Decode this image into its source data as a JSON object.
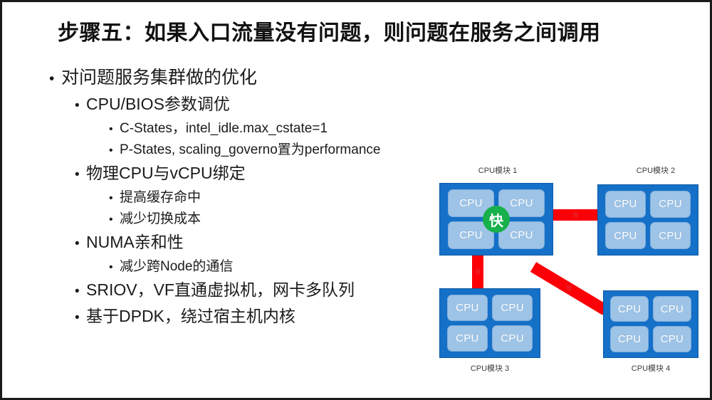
{
  "slide": {
    "title": "步骤五：如果入口流量没有问题，则问题在服务之间调用",
    "bullet_char": "•"
  },
  "outline": [
    {
      "level": 1,
      "text": "对问题服务集群做的优化"
    },
    {
      "level": 2,
      "text": "CPU/BIOS参数调优"
    },
    {
      "level": 3,
      "text": "C-States，intel_idle.max_cstate=1"
    },
    {
      "level": 3,
      "text": "P-States, scaling_governo置为performance"
    },
    {
      "level": 2,
      "text": "物理CPU与vCPU绑定"
    },
    {
      "level": 3,
      "text": "提高缓存命中"
    },
    {
      "level": 3,
      "text": "减少切换成本"
    },
    {
      "level": 2,
      "text": "NUMA亲和性"
    },
    {
      "level": 3,
      "text": "减少跨Node的通信"
    },
    {
      "level": 2,
      "text": "SRIOV，VF直通虚拟机，网卡多队列"
    },
    {
      "level": 2,
      "text": "基于DPDK，绕过宿主机内核"
    }
  ],
  "diagram": {
    "cpu_cell_label": "CPU",
    "fast_badge_label": "快",
    "modules": [
      {
        "id": "module-1",
        "label": "CPU模块 1",
        "label_position": "top"
      },
      {
        "id": "module-2",
        "label": "CPU模块 2",
        "label_position": "top"
      },
      {
        "id": "module-3",
        "label": "CPU模块 3",
        "label_position": "bottom"
      },
      {
        "id": "module-4",
        "label": "CPU模块 4",
        "label_position": "bottom"
      }
    ],
    "links": [
      {
        "id": "link-1-2",
        "label": "慢",
        "orientation": "horizontal"
      },
      {
        "id": "link-1-3",
        "label": "慢",
        "orientation": "vertical"
      },
      {
        "id": "link-1-4",
        "label": "慢",
        "orientation": "diagonal"
      }
    ],
    "colors": {
      "module_fill": "#1570C8",
      "cpu_cell_fill": "#9DC3E6",
      "link_fill": "#FB0007",
      "fast_badge_fill": "#17B04A",
      "slide_background": "#FFFFFF",
      "title_color": "#111111"
    }
  }
}
